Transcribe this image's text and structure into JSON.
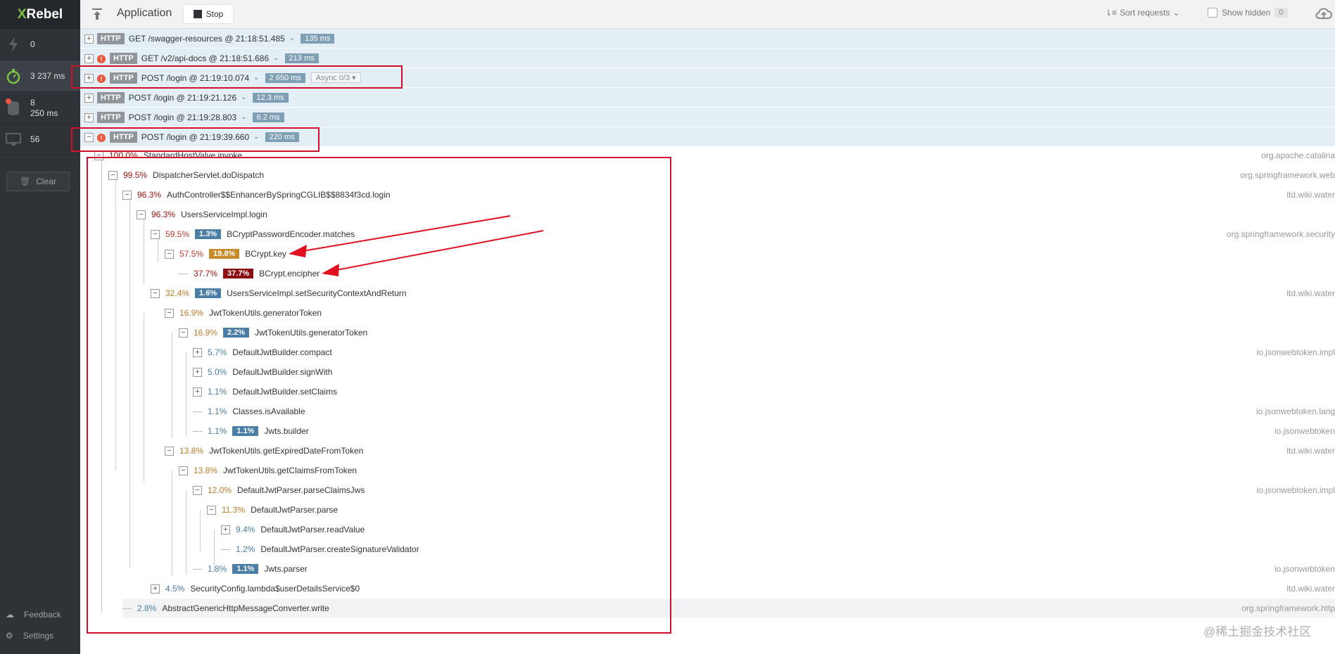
{
  "sidebar": {
    "logo_x": "X",
    "logo_rest": "Rebel",
    "items": [
      {
        "label": "0"
      },
      {
        "label": "3 237 ms"
      },
      {
        "label": "8",
        "sub": "250 ms"
      },
      {
        "label": "56"
      }
    ],
    "clear_label": "Clear",
    "feedback_label": "Feedback",
    "settings_label": "Settings"
  },
  "topbar": {
    "title": "Application",
    "stop_label": "Stop",
    "sort_label": "Sort requests",
    "show_hidden_label": "Show hidden",
    "hidden_count": "0"
  },
  "requests": [
    {
      "http": "HTTP",
      "text": "GET /swagger-resources @ 21:18:51.485",
      "ms": "135 ms",
      "warn": false,
      "expanded": false
    },
    {
      "http": "HTTP",
      "text": "GET /v2/api-docs @ 21:18:51.686",
      "ms": "213 ms",
      "warn": true,
      "expanded": false
    },
    {
      "http": "HTTP",
      "text": "POST /login @ 21:19:10.074",
      "ms": "2 650 ms",
      "warn": true,
      "expanded": false,
      "async": "Async 0/3"
    },
    {
      "http": "HTTP",
      "text": "POST /login @ 21:19:21.126",
      "ms": "12.3 ms",
      "warn": false,
      "expanded": false
    },
    {
      "http": "HTTP",
      "text": "POST /login @ 21:19:28.803",
      "ms": "6.2 ms",
      "warn": false,
      "expanded": false
    },
    {
      "http": "HTTP",
      "text": "POST /login @ 21:19:39.660",
      "ms": "220 ms",
      "warn": true,
      "expanded": true
    }
  ],
  "tree": [
    {
      "pct": "100.0%",
      "name": "StandardHostValve.invoke",
      "pkg": "org.apache.catalina",
      "self": ""
    },
    {
      "pct": "99.5%",
      "name": "DispatcherServlet.doDispatch",
      "pkg": "org.springframework.web",
      "self": ""
    },
    {
      "pct": "96.3%",
      "name": "AuthController$$EnhancerBySpringCGLIB$$8834f3cd.login",
      "pkg": "ltd.wiki.water",
      "self": ""
    },
    {
      "pct": "96.3%",
      "name": "UsersServiceImpl.login",
      "pkg": "",
      "self": ""
    },
    {
      "pct": "59.5%",
      "name": "BCryptPasswordEncoder.matches",
      "pkg": "org.springframework.security",
      "self": "1.3%"
    },
    {
      "pct": "57.5%",
      "name": "BCrypt.key",
      "pkg": "",
      "self": "19.8%"
    },
    {
      "pct": "37.7%",
      "name": "BCrypt.encipher",
      "pkg": "",
      "self": "37.7%"
    },
    {
      "pct": "32.4%",
      "name": "UsersServiceImpl.setSecurityContextAndReturn",
      "pkg": "ltd.wiki.water",
      "self": "1.6%"
    },
    {
      "pct": "16.9%",
      "name": "JwtTokenUtils.generatorToken",
      "pkg": "",
      "self": ""
    },
    {
      "pct": "16.9%",
      "name": "JwtTokenUtils.generatorToken",
      "pkg": "",
      "self": "2.2%"
    },
    {
      "pct": "5.7%",
      "name": "DefaultJwtBuilder.compact",
      "pkg": "io.jsonwebtoken.impl",
      "self": ""
    },
    {
      "pct": "5.0%",
      "name": "DefaultJwtBuilder.signWith",
      "pkg": "",
      "self": ""
    },
    {
      "pct": "1.1%",
      "name": "DefaultJwtBuilder.setClaims",
      "pkg": "",
      "self": ""
    },
    {
      "pct": "1.1%",
      "name": "Classes.isAvailable",
      "pkg": "io.jsonwebtoken.lang",
      "self": ""
    },
    {
      "pct": "1.1%",
      "name": "Jwts.builder",
      "pkg": "io.jsonwebtoken",
      "self": "1.1%"
    },
    {
      "pct": "13.8%",
      "name": "JwtTokenUtils.getExpiredDateFromToken",
      "pkg": "ltd.wiki.water",
      "self": ""
    },
    {
      "pct": "13.8%",
      "name": "JwtTokenUtils.getClaimsFromToken",
      "pkg": "",
      "self": ""
    },
    {
      "pct": "12.0%",
      "name": "DefaultJwtParser.parseClaimsJws",
      "pkg": "io.jsonwebtoken.impl",
      "self": ""
    },
    {
      "pct": "11.3%",
      "name": "DefaultJwtParser.parse",
      "pkg": "",
      "self": ""
    },
    {
      "pct": "9.4%",
      "name": "DefaultJwtParser.readValue",
      "pkg": "",
      "self": ""
    },
    {
      "pct": "1.2%",
      "name": "DefaultJwtParser.createSignatureValidator",
      "pkg": "",
      "self": ""
    },
    {
      "pct": "1.8%",
      "name": "Jwts.parser",
      "pkg": "io.jsonwebtoken",
      "self": "1.1%"
    },
    {
      "pct": "4.5%",
      "name": "SecurityConfig.lambda$userDetailsService$0",
      "pkg": "ltd.wiki.water",
      "self": ""
    },
    {
      "pct": "2.8%",
      "name": "AbstractGenericHttpMessageConverter.write",
      "pkg": "org.springframework.http",
      "self": ""
    }
  ],
  "colors": {
    "self_blue": "#4a7ea6",
    "self_orange": "#c98a2a",
    "self_dark_red": "#8b0d0d",
    "highlight": "#d0102a"
  },
  "watermark": "@稀土掘金技术社区"
}
